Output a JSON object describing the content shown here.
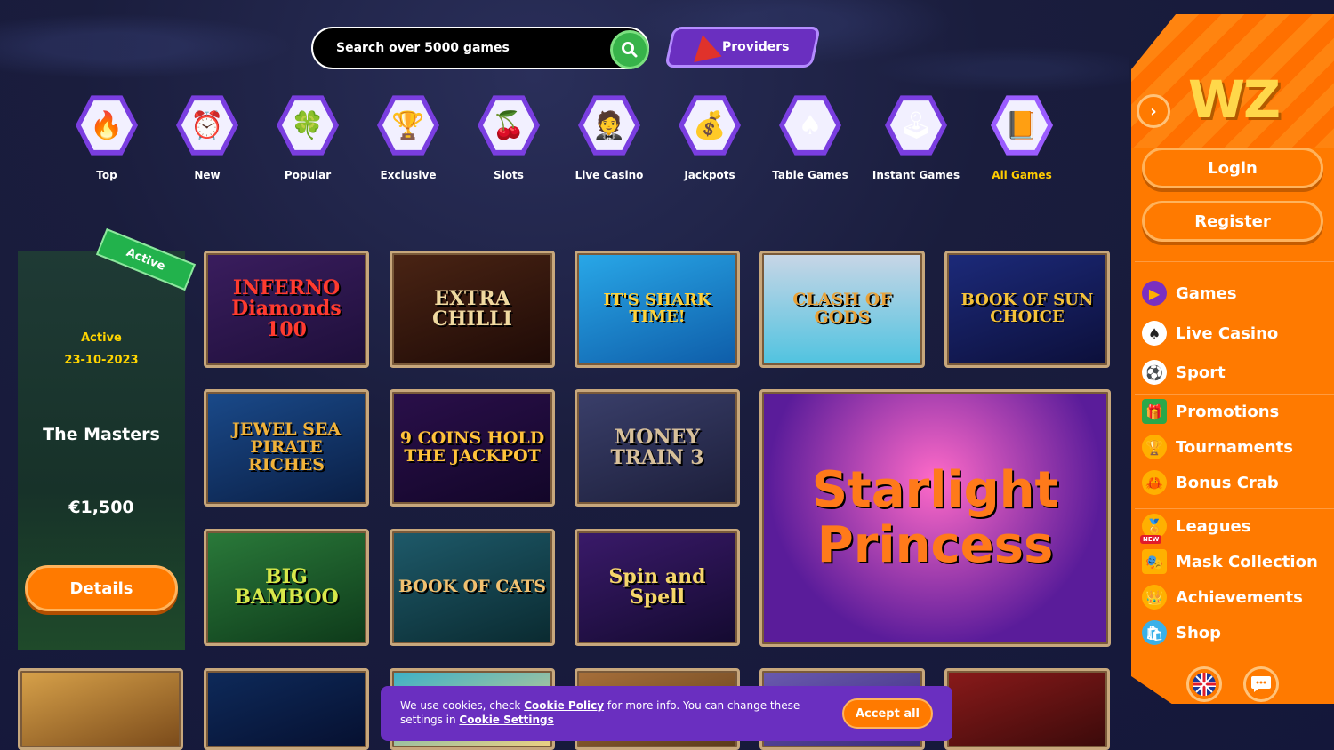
{
  "search": {
    "placeholder": "Search over 5000 games"
  },
  "providers": {
    "label": "Providers"
  },
  "categories": [
    {
      "label": "Top",
      "icon": "🔥"
    },
    {
      "label": "New",
      "icon": "⏰"
    },
    {
      "label": "Popular",
      "icon": "🍀"
    },
    {
      "label": "Exclusive",
      "icon": "🏆"
    },
    {
      "label": "Slots",
      "icon": "🍒"
    },
    {
      "label": "Live Casino",
      "icon": "🤵"
    },
    {
      "label": "Jackpots",
      "icon": "💰"
    },
    {
      "label": "Table Games",
      "icon": "♠"
    },
    {
      "label": "Instant Games",
      "icon": "🕹"
    },
    {
      "label": "All Games",
      "icon": "📙"
    }
  ],
  "tournament": {
    "ribbon": "Active",
    "status": "Active",
    "date": "23-10-2023",
    "name": "The Masters",
    "prize": "€1,500",
    "details": "Details"
  },
  "games": [
    {
      "title": "INFERNO Diamonds 100"
    },
    {
      "title": "EXTRA CHILLI"
    },
    {
      "title": "IT'S SHARK TIME!"
    },
    {
      "title": "CLASH OF GODS"
    },
    {
      "title": "BOOK OF SUN CHOICE"
    },
    {
      "title": "JEWEL SEA PIRATE RICHES"
    },
    {
      "title": "9 COINS HOLD THE JACKPOT"
    },
    {
      "title": "MONEY TRAIN 3"
    },
    {
      "title": "Starlight Princess"
    },
    {
      "title": "BIG BAMBOO"
    },
    {
      "title": "BOOK OF CATS"
    },
    {
      "title": "Spin and Spell"
    }
  ],
  "sidebar": {
    "logo": "WZ",
    "login": "Login",
    "register": "Register",
    "items": [
      {
        "label": "Games"
      },
      {
        "label": "Live Casino"
      },
      {
        "label": "Sport"
      },
      {
        "label": "Promotions"
      },
      {
        "label": "Tournaments"
      },
      {
        "label": "Bonus Crab"
      },
      {
        "label": "Leagues",
        "badge": "NEW"
      },
      {
        "label": "Mask Collection"
      },
      {
        "label": "Achievements"
      },
      {
        "label": "Shop"
      }
    ]
  },
  "cookie": {
    "text_pre": "We use cookies, check ",
    "policy_link": "Cookie Policy",
    "text_mid": " for more info. You can change these settings in ",
    "settings_link": "Cookie Settings",
    "accept": "Accept all"
  },
  "colors": {
    "accent": "#ff7a00",
    "purple": "#6a2fc0",
    "active": "#ffcc00",
    "search_green": "#37b34a"
  }
}
